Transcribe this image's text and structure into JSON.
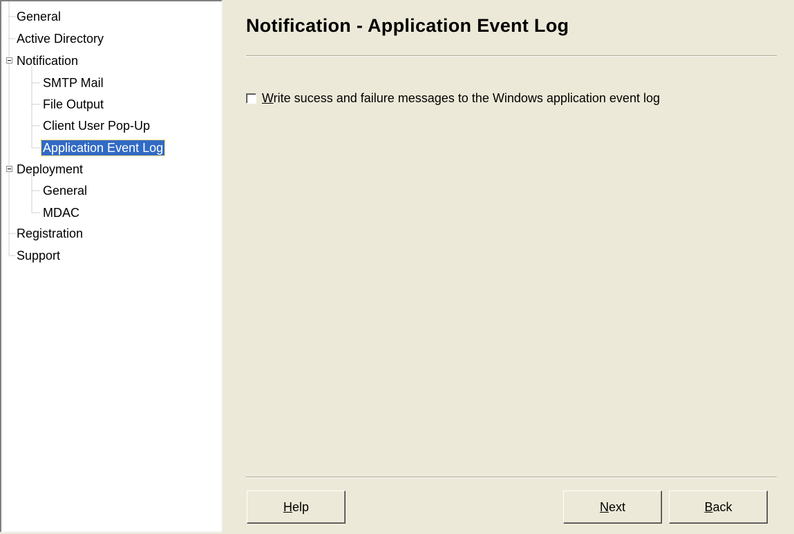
{
  "tree": {
    "items": [
      {
        "label": "General"
      },
      {
        "label": "Active Directory"
      },
      {
        "label": "Notification"
      },
      {
        "label": "SMTP Mail"
      },
      {
        "label": "File Output"
      },
      {
        "label": "Client User Pop-Up"
      },
      {
        "label": "Application Event Log",
        "selected": true
      },
      {
        "label": "Deployment"
      },
      {
        "label": "General"
      },
      {
        "label": "MDAC"
      },
      {
        "label": "Registration"
      },
      {
        "label": "Support"
      }
    ]
  },
  "page": {
    "title": "Notification - Application Event Log"
  },
  "checkbox": {
    "accelerator": "W",
    "label_rest": "rite sucess and failure messages to the Windows application event log",
    "checked": false
  },
  "buttons": {
    "help": {
      "acc": "H",
      "rest": "elp"
    },
    "next": {
      "acc": "N",
      "rest": "ext"
    },
    "back": {
      "acc": "B",
      "rest": "ack"
    }
  },
  "colors": {
    "background": "#ece9d8",
    "selection": "#316ac5"
  }
}
